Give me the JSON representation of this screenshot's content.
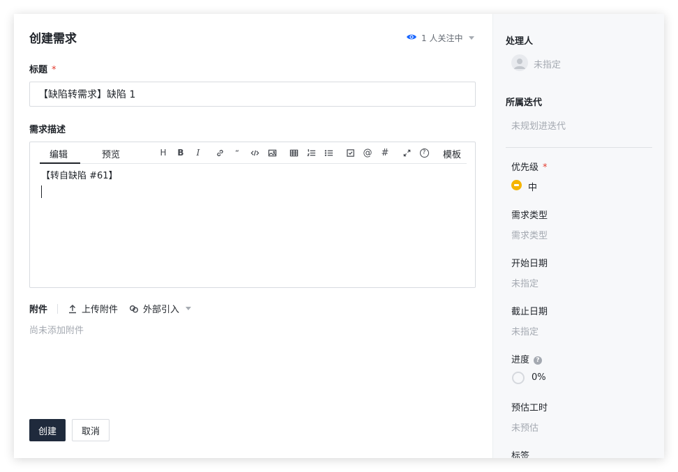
{
  "dialog": {
    "title": "创建需求",
    "watch_text": "1 人关注中",
    "colors": {
      "accent": "#1664ff",
      "primary_button": "#1f2a3c",
      "required": "#e33b2e",
      "priority_medium": "#f5b400"
    }
  },
  "form": {
    "title_label": "标题",
    "required_mark": "*",
    "title_value": "【缺陷转需求】缺陷 1",
    "desc_label": "需求描述",
    "editor": {
      "tab_edit": "编辑",
      "tab_preview": "预览",
      "toolbar": {
        "heading": "H",
        "bold": "B",
        "italic": "I",
        "quote": "“",
        "mention": "@",
        "hash": "#",
        "help": "?",
        "template": "模板"
      },
      "content": "【转自缺陷 #61】"
    },
    "attachments": {
      "label": "附件",
      "upload": "上传附件",
      "external": "外部引入",
      "empty": "尚未添加附件"
    },
    "buttons": {
      "create": "创建",
      "cancel": "取消"
    }
  },
  "sidebar": {
    "assignee_label": "处理人",
    "assignee_value": "未指定",
    "iteration_label": "所属迭代",
    "iteration_value": "未规划进迭代",
    "priority_label": "优先级",
    "priority_required": "*",
    "priority_value": "中",
    "type_label": "需求类型",
    "type_value": "需求类型",
    "start_label": "开始日期",
    "start_value": "未指定",
    "due_label": "截止日期",
    "due_value": "未指定",
    "progress_label": "进度",
    "progress_help": "?",
    "progress_value": "0%",
    "estimate_label": "预估工时",
    "estimate_value": "未预估",
    "tags_label": "标签"
  }
}
